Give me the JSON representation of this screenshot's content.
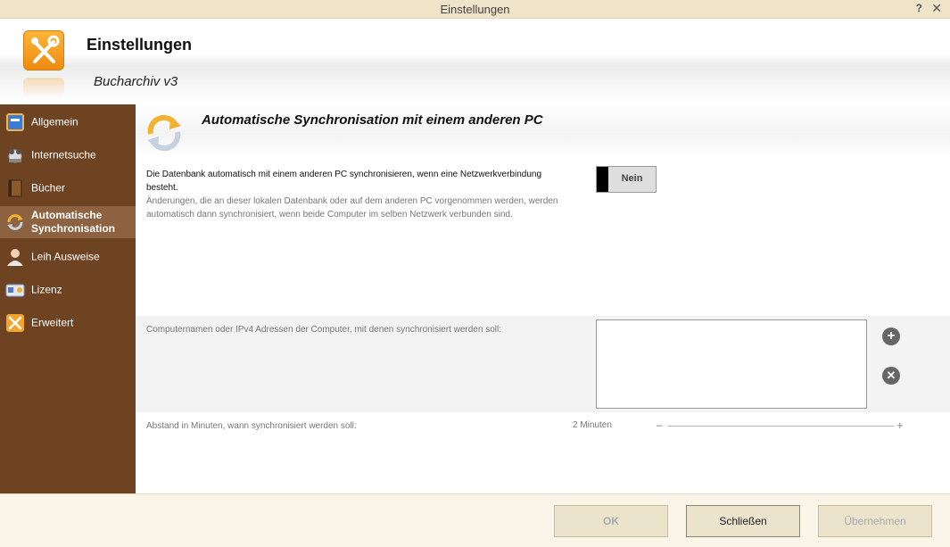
{
  "window": {
    "title": "Einstellungen",
    "help_glyph": "?",
    "close_glyph": "✕"
  },
  "header": {
    "title": "Einstellungen",
    "subtitle": "Bucharchiv v3",
    "icon": "tools-icon"
  },
  "sidebar": {
    "items": [
      {
        "label": "Allgemein",
        "icon": "general-book-icon",
        "active": false
      },
      {
        "label": "Internetsuche",
        "icon": "internet-search-icon",
        "active": false
      },
      {
        "label": "Bücher",
        "icon": "books-icon",
        "active": false
      },
      {
        "label": "Automatische Synchronisation",
        "icon": "sync-icon",
        "active": true
      },
      {
        "label": "Leih Ausweise",
        "icon": "person-icon",
        "active": false
      },
      {
        "label": "Lizenz",
        "icon": "license-card-icon",
        "active": false
      },
      {
        "label": "Erweitert",
        "icon": "tools-icon",
        "active": false
      }
    ]
  },
  "section": {
    "title": "Automatische Synchronisation mit einem anderen PC",
    "description": "Die Datenbank automatisch mit einem anderen PC synchronisieren, wenn eine Netzwerkverbindung besteht.",
    "description_sub": "Änderungen, die an dieser lokalen Datenbank oder auf dem anderen PC vorgenommen werden, werden automatisch dann synchronisiert, wenn beide Computer im selben Netzwerk verbunden sind.",
    "toggle_label": "Nein",
    "hosts_label": "Computernamen oder IPv4 Adressen der Computer, mit denen synchronisiert werden soll:",
    "hosts_value": "",
    "add_glyph": "+",
    "remove_glyph": "✕",
    "interval_label": "Abstand in Minuten, wann synchronisiert werden soll:",
    "interval_value": "2 Minuten",
    "slider_minus": "–",
    "slider_plus": "+"
  },
  "footer": {
    "ok": "OK",
    "close": "Schließen",
    "apply": "Übernehmen"
  },
  "colors": {
    "sidebar": "#6e4321",
    "sidebar_active": "#8c6241",
    "accent": "#f5a623",
    "footer": "#faf5e9"
  }
}
